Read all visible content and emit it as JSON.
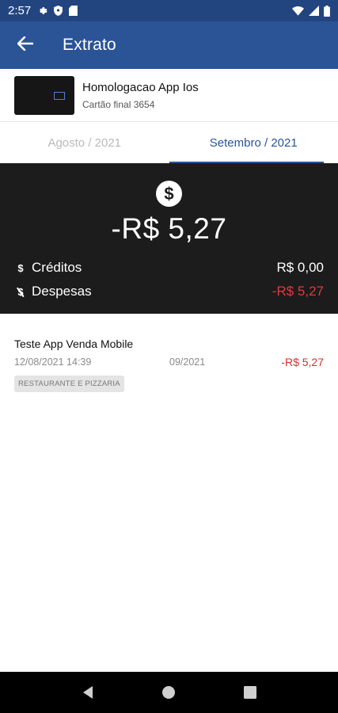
{
  "status_bar": {
    "time": "2:57",
    "left_icons": [
      "gear-icon",
      "shield-icon",
      "sd-card-icon"
    ],
    "right_icons": [
      "wifi-icon",
      "signal-icon",
      "battery-icon"
    ]
  },
  "app_bar": {
    "title": "Extrato",
    "back_icon": "arrow-left-icon"
  },
  "card": {
    "name": "Homologacao App Ios",
    "subtitle": "Cartão final 3654"
  },
  "tabs": [
    {
      "label": "Agosto / 2021",
      "active": false
    },
    {
      "label": "Setembro / 2021",
      "active": true
    }
  ],
  "summary": {
    "total": "-R$  5,27",
    "credits_label": "Créditos",
    "credits_value": "R$  0,00",
    "expenses_label": "Despesas",
    "expenses_value": "-R$  5,27",
    "negative_color": "#e03a3a"
  },
  "transactions": [
    {
      "title": "Teste App Venda Mobile",
      "date": "12/08/2021 14:39",
      "reference": "09/2021",
      "value": "-R$  5,27",
      "category": "RESTAURANTE E PIZZARIA"
    }
  ],
  "colors": {
    "primary": "#2b5496",
    "status_bar": "#23457f",
    "summary_bg": "#1c1c1c"
  }
}
